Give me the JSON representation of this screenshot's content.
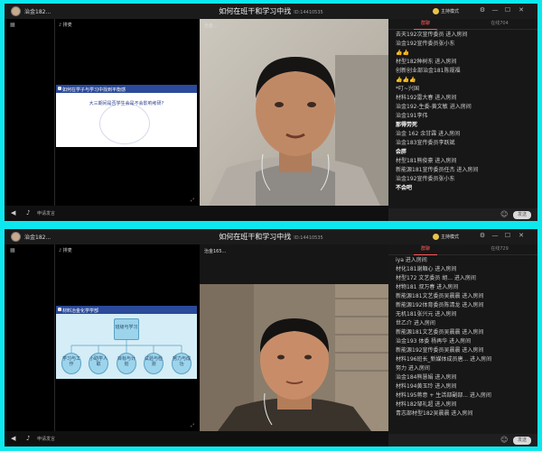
{
  "colors": {
    "frame": "#0de8ee",
    "active_tab": "#ff5a5a",
    "slide_header": "#2b4a9a"
  },
  "windows": [
    {
      "host_name": "治金182...",
      "title": "如何在班干和学习中找",
      "room_id": "ID:14410535",
      "mode_label": "主持模式",
      "ppt_label": "排麦",
      "cam_label": "治金...",
      "apply_label": "申请发言",
      "send_label": "发送",
      "tabs": [
        "群聊",
        "在线704"
      ],
      "slide": {
        "header": "如何在学子与学习中找到平衡感",
        "question": "大三期间是否学生会是不会影响考研?"
      },
      "chat": [
        {
          "text": "去天192次宣传委员 进入房间",
          "style": ""
        },
        {
          "text": "治金192宣传委员张小东",
          "style": ""
        },
        {
          "text": "👍👍",
          "style": "thumb"
        },
        {
          "text": "材型182种树东 进入房间",
          "style": ""
        },
        {
          "text": "创新创业部治金181陈规福",
          "style": ""
        },
        {
          "text": "👍👍👍",
          "style": "thumb"
        },
        {
          "text": "*叮~兴国",
          "style": ""
        },
        {
          "text": "",
          "style": ""
        },
        {
          "text": "材科192雷大春 进入房间",
          "style": ""
        },
        {
          "text": "治金192-生委-黄文敏 进入房间",
          "style": ""
        },
        {
          "text": "治金191李伟",
          "style": ""
        },
        {
          "text": "那得劳死",
          "style": "em"
        },
        {
          "text": "治金 162 余甘霖 进入房间",
          "style": ""
        },
        {
          "text": "治金183宣传委员李跃斌",
          "style": ""
        },
        {
          "text": "会胖",
          "style": "em"
        },
        {
          "text": "材型181熊俊豪 进入房间",
          "style": ""
        },
        {
          "text": "新能源181宣传委员任杰 进入房间",
          "style": ""
        },
        {
          "text": "治金192宣传委员张小东",
          "style": ""
        },
        {
          "text": "不会吧",
          "style": "em"
        }
      ]
    },
    {
      "host_name": "治金182...",
      "title": "如何在班干和学习中找",
      "room_id": "ID:14410535",
      "mode_label": "主持模式",
      "ppt_label": "排麦",
      "cam_label": "治金165...",
      "apply_label": "申请发言",
      "send_label": "发送",
      "tabs": [
        "群聊",
        "在线729"
      ],
      "slide": {
        "header": "材料冶金化学学部",
        "root": "班级与学习",
        "children": [
          "学习与工作",
          "小助学人取",
          "目标与计划",
          "试验与检测",
          "努力与成功"
        ]
      },
      "chat": [
        {
          "text": "iya 进入房间",
          "style": ""
        },
        {
          "text": "材化181谢順心 进入房间",
          "style": ""
        },
        {
          "text": "材型172 文艺委员 胡... 进入房间",
          "style": ""
        },
        {
          "text": "材物181 叔万春 进入房间",
          "style": ""
        },
        {
          "text": "新能源181文艺委员吴晨晨 进入房间",
          "style": ""
        },
        {
          "text": "新能源192体育委员陈清龙 进入房间",
          "style": ""
        },
        {
          "text": "无机181张兴元 进入房间",
          "style": ""
        },
        {
          "text": "世乙介 进入房间",
          "style": ""
        },
        {
          "text": "新能源181文艺委员吴晨晨 进入房间",
          "style": ""
        },
        {
          "text": "治金193 体委 杨再华 进入房间",
          "style": ""
        },
        {
          "text": "新能源192宣传委员吴晨晨 进入房间",
          "style": ""
        },
        {
          "text": "材料196班长_新媒体成员唐... 进入房间",
          "style": ""
        },
        {
          "text": "努力 进入房间",
          "style": ""
        },
        {
          "text": "治金184熊慧娟 进入房间",
          "style": ""
        },
        {
          "text": "材料194黄玉玲 进入房间",
          "style": ""
        },
        {
          "text": "材料195蒋意 + 生活部副部... 进入房间",
          "style": ""
        },
        {
          "text": "材料182邹礼超 进入房间",
          "style": ""
        },
        {
          "text": "青志部材型182吴晨晨 进入房间",
          "style": ""
        }
      ]
    }
  ]
}
